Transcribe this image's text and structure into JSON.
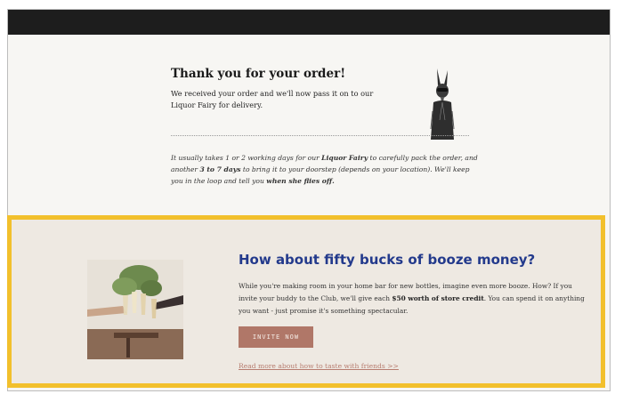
{
  "confirmation": {
    "title": "Thank you for your order!",
    "message": "We received your order and we'll now pass it on to our Liquor Fairy for delivery.",
    "delivery_part1": "It usually takes 1 or 2 working days for our ",
    "delivery_fairy": "Liquor Fairy",
    "delivery_part2": " to carefully pack the order, and another ",
    "delivery_days": "3 to 7 days",
    "delivery_part3": " to bring it to your doorstep (depends on your location). We'll keep you in the loop and tell you ",
    "delivery_flies": "when she flies off.",
    "mascot_icon": "rabbit-mascot-icon"
  },
  "promo": {
    "title": "How about fifty bucks of booze money?",
    "body_part1": "While you're making room in your home bar for new bottles, imagine even more booze. How? If you invite your buddy to the Club, we'll give each ",
    "body_credit": "$50 worth of store credit",
    "body_part2": ". You can spend it on anything you want - just promise it's something spectacular.",
    "invite_label": "INVITE NOW",
    "read_more_label": "Read more about how to taste with friends >>",
    "photo_icon": "toasting-glasses-photo"
  },
  "colors": {
    "header": "#1d1d1d",
    "highlight_border": "#f2c02c",
    "promo_title": "#233a8c",
    "button": "#b07768",
    "link": "#b77d70"
  }
}
